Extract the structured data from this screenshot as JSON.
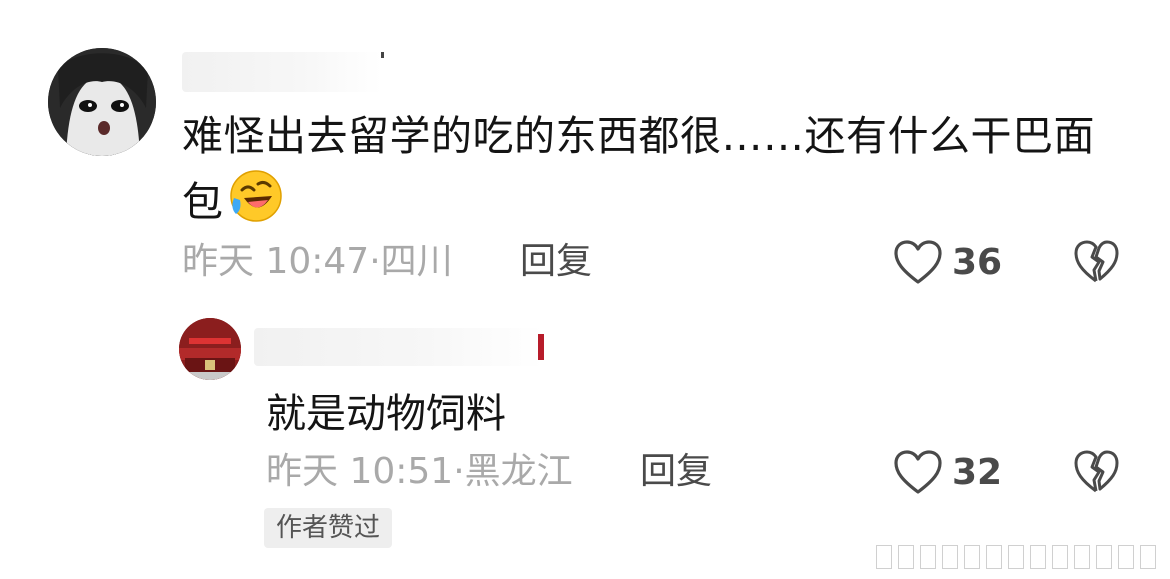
{
  "main_comment": {
    "text": "难怪出去留学的吃的东西都很……还有什么干巴面包",
    "emoji": "rofl-emoji",
    "time": "昨天 10:47",
    "location": "四川",
    "reply_label": "回复",
    "likes": "36"
  },
  "reply_comment": {
    "text": "就是动物饲料",
    "time": "昨天 10:51",
    "location": "黑龙江",
    "reply_label": "回复",
    "likes": "32",
    "badge": "作者赞过"
  },
  "icons": {
    "like": "heart-outline-icon",
    "dislike": "broken-heart-icon"
  },
  "colors": {
    "meta_gray": "#a9a9a9",
    "text_dark": "#141414",
    "badge_bg": "#eeeeee"
  }
}
